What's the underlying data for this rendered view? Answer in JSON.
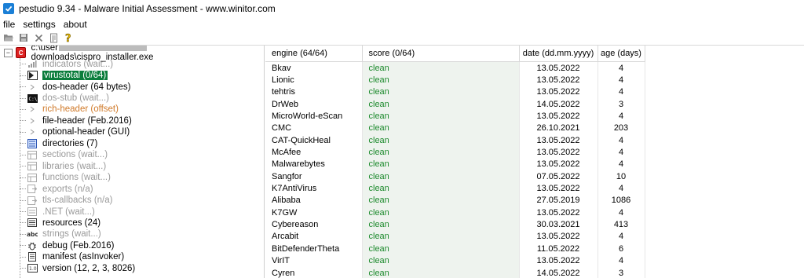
{
  "window": {
    "title": "pestudio 9.34 - Malware Initial Assessment - www.winitor.com"
  },
  "menu": {
    "items": [
      "file",
      "settings",
      "about"
    ]
  },
  "toolbar": {
    "icons": [
      "open-folder-icon",
      "save-icon",
      "close-x-icon",
      "document-icon",
      "help-icon"
    ]
  },
  "tree": {
    "root": {
      "prefix": "c:\\user",
      "suffix": "downloads\\cispro_installer.exe"
    },
    "items": [
      {
        "label": "indicators (wait...)",
        "state": "grey",
        "icon": "indicators-icon"
      },
      {
        "label": "virustotal (0/64)",
        "state": "selected",
        "icon": "virustotal-icon"
      },
      {
        "label": "dos-header (64 bytes)",
        "state": "black",
        "icon": "arrow-icon"
      },
      {
        "label": "dos-stub (wait...)",
        "state": "grey",
        "icon": "terminal-icon"
      },
      {
        "label": "rich-header (offset)",
        "state": "orange",
        "icon": "arrow-icon"
      },
      {
        "label": "file-header (Feb.2016)",
        "state": "black",
        "icon": "arrow-icon"
      },
      {
        "label": "optional-header (GUI)",
        "state": "black",
        "icon": "arrow-icon"
      },
      {
        "label": "directories (7)",
        "state": "black",
        "icon": "directories-icon"
      },
      {
        "label": "sections (wait...)",
        "state": "grey",
        "icon": "sections-icon"
      },
      {
        "label": "libraries (wait...)",
        "state": "grey",
        "icon": "libraries-icon"
      },
      {
        "label": "functions (wait...)",
        "state": "grey",
        "icon": "functions-icon"
      },
      {
        "label": "exports (n/a)",
        "state": "grey",
        "icon": "exports-icon"
      },
      {
        "label": "tls-callbacks (n/a)",
        "state": "grey",
        "icon": "tls-callbacks-icon"
      },
      {
        "label": ".NET (wait...)",
        "state": "grey",
        "icon": "dotnet-icon"
      },
      {
        "label": "resources (24)",
        "state": "black",
        "icon": "resources-icon"
      },
      {
        "label": "strings (wait...)",
        "state": "grey",
        "icon": "strings-icon"
      },
      {
        "label": "debug (Feb.2016)",
        "state": "black",
        "icon": "debug-icon"
      },
      {
        "label": "manifest (asInvoker)",
        "state": "black",
        "icon": "manifest-icon"
      },
      {
        "label": "version (12, 2, 3, 8026)",
        "state": "black",
        "icon": "version-icon"
      }
    ]
  },
  "table": {
    "columns": [
      "engine (64/64)",
      "score (0/64)",
      "date (dd.mm.yyyy)",
      "age (days)"
    ],
    "rows": [
      [
        "Bkav",
        "clean",
        "13.05.2022",
        "4"
      ],
      [
        "Lionic",
        "clean",
        "13.05.2022",
        "4"
      ],
      [
        "tehtris",
        "clean",
        "13.05.2022",
        "4"
      ],
      [
        "DrWeb",
        "clean",
        "14.05.2022",
        "3"
      ],
      [
        "MicroWorld-eScan",
        "clean",
        "13.05.2022",
        "4"
      ],
      [
        "CMC",
        "clean",
        "26.10.2021",
        "203"
      ],
      [
        "CAT-QuickHeal",
        "clean",
        "13.05.2022",
        "4"
      ],
      [
        "McAfee",
        "clean",
        "13.05.2022",
        "4"
      ],
      [
        "Malwarebytes",
        "clean",
        "13.05.2022",
        "4"
      ],
      [
        "Sangfor",
        "clean",
        "07.05.2022",
        "10"
      ],
      [
        "K7AntiVirus",
        "clean",
        "13.05.2022",
        "4"
      ],
      [
        "Alibaba",
        "clean",
        "27.05.2019",
        "1086"
      ],
      [
        "K7GW",
        "clean",
        "13.05.2022",
        "4"
      ],
      [
        "Cybereason",
        "clean",
        "30.03.2021",
        "413"
      ],
      [
        "Arcabit",
        "clean",
        "13.05.2022",
        "4"
      ],
      [
        "BitDefenderTheta",
        "clean",
        "11.05.2022",
        "6"
      ],
      [
        "VirIT",
        "clean",
        "13.05.2022",
        "4"
      ],
      [
        "Cyren",
        "clean",
        "14.05.2022",
        "3"
      ]
    ]
  },
  "colors": {
    "accent": "#1a7fd6",
    "selected_bg": "#0b7d3c",
    "clean_text": "#1c8a2c",
    "grey_text": "#9a9a9a",
    "orange_text": "#d07a2a"
  }
}
